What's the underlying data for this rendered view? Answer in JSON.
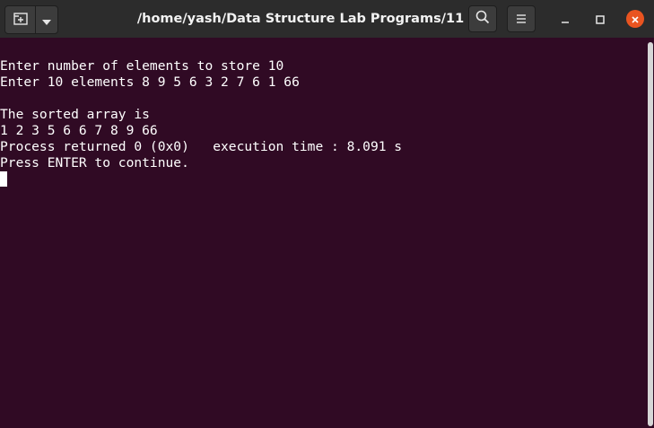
{
  "window": {
    "title": "/home/yash/Data Structure Lab Programs/11"
  },
  "titlebar": {
    "icons": [
      "new-tab-icon",
      "dropdown-chevron-icon",
      "search-icon",
      "hamburger-menu-icon",
      "minimize-icon",
      "maximize-icon",
      "close-icon"
    ],
    "close_color": "#e95420"
  },
  "terminal": {
    "background": "#300a24",
    "lines": [
      "Enter number of elements to store 10",
      "Enter 10 elements 8 9 5 6 3 2 7 6 1 66",
      "",
      "The sorted array is",
      "1 2 3 5 6 6 7 8 9 66",
      "Process returned 0 (0x0)   execution time : 8.091 s",
      "Press ENTER to continue."
    ]
  }
}
